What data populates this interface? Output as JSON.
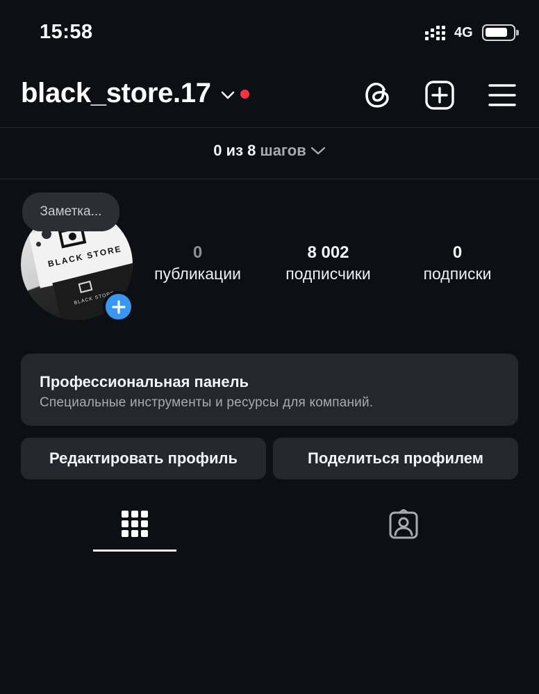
{
  "status_bar": {
    "time": "15:58",
    "network": "4G",
    "icons": [
      "signal-icon",
      "battery-icon"
    ]
  },
  "header": {
    "username": "black_store.17",
    "icons": [
      "chevron-down-icon",
      "notification-dot",
      "threads-icon",
      "add-post-icon",
      "menu-icon"
    ],
    "notification_dot_color": "#ff3040"
  },
  "onboarding": {
    "progress_bold": "0 из 8",
    "progress_muted": "шагов"
  },
  "profile": {
    "note_placeholder": "Заметка...",
    "avatar_text": "BLACK STORE",
    "avatar_text_small": "BLACK STORE",
    "stats": [
      {
        "value": "0",
        "label": "публикации"
      },
      {
        "value": "8 002",
        "label": "подписчики"
      },
      {
        "value": "0",
        "label": "подписки"
      }
    ]
  },
  "pro_panel": {
    "title": "Профессиональная панель",
    "subtitle": "Специальные инструменты и ресурсы для компаний."
  },
  "buttons": {
    "edit_profile": "Редактировать профиль",
    "share_profile": "Поделиться профилем"
  },
  "tabs": [
    {
      "icon": "grid-icon",
      "active": true
    },
    {
      "icon": "tagged-icon",
      "active": false
    }
  ],
  "colors": {
    "background": "#0c0f14",
    "surface": "#24272e",
    "accent_blue": "#3897f0"
  }
}
